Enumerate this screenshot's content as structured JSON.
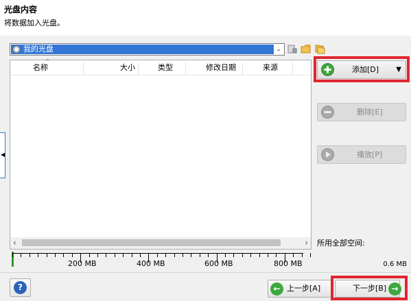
{
  "header": {
    "title": "光盘内容",
    "subtitle": "将数据加入光盘。"
  },
  "disc_selector": {
    "selected": "我的光盘"
  },
  "file_list": {
    "columns": [
      "名称",
      "大小",
      "类型",
      "修改日期",
      "来源"
    ],
    "rows": []
  },
  "ruler": {
    "labels": [
      "200 MB",
      "400 MB",
      "600 MB",
      "800 MB"
    ]
  },
  "side_buttons": {
    "add": "添加[D]",
    "delete": "删除[E]",
    "play": "播放[P]"
  },
  "space": {
    "label": "所用全部空间:",
    "value": "0.6 MB"
  },
  "nav": {
    "help": "?",
    "back": "上一步[A]",
    "next": "下一步[B]"
  },
  "colors": {
    "selection": "#3276d6",
    "highlight": "#e0262e",
    "accent_green": "#3ea83e",
    "help_blue": "#2c62b9"
  },
  "icons": {
    "disc": "disc-icon",
    "tb1": "properties-icon",
    "tb2": "new-folder-icon",
    "tb3": "copy-icon"
  }
}
